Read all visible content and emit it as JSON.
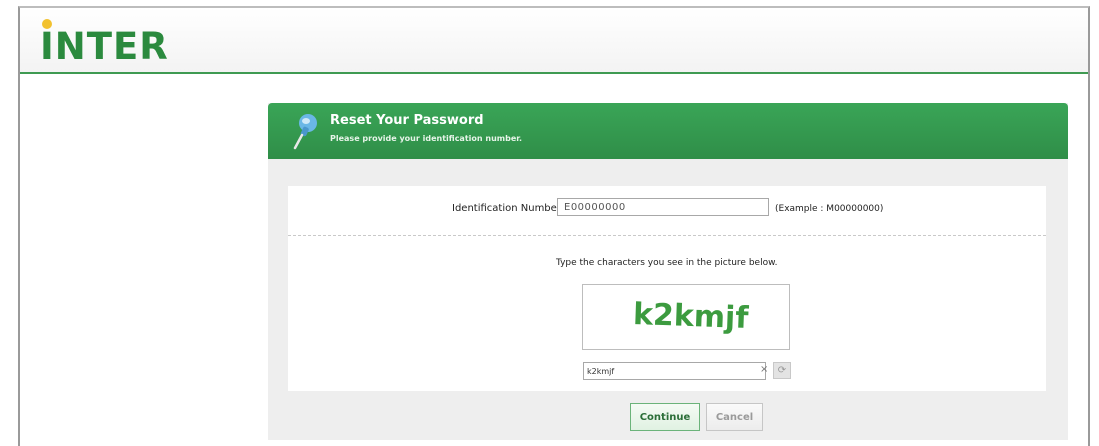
{
  "header": {
    "logo_text": "INTER"
  },
  "panel": {
    "title": "Reset Your Password",
    "subtitle": "Please provide your identification number."
  },
  "form": {
    "id_label": "Identification Number",
    "id_value": "E00000000",
    "id_example": "(Example : M00000000)",
    "captcha_instructions": "Type the characters you see in the picture below.",
    "captcha_image_text": "k2kmjf",
    "captcha_input_value": "k2kmjf",
    "clear_symbol": "×",
    "refresh_symbol": "⟳"
  },
  "buttons": {
    "continue_label": "Continue",
    "cancel_label": "Cancel"
  },
  "colors": {
    "brand_green": "#2b8a3e",
    "header_green": "#3aa557",
    "logo_dot": "#f2c12e"
  },
  "icons": {
    "panel_icon": "pushpin-icon",
    "clear_icon": "clear-icon",
    "refresh_icon": "refresh-icon"
  }
}
